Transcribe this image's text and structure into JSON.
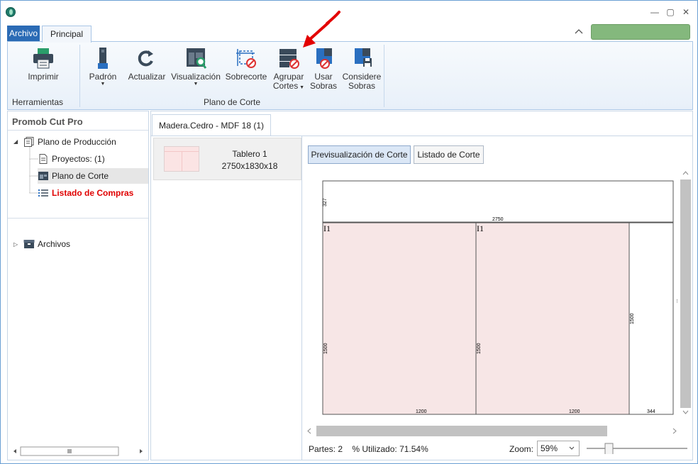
{
  "titlebar": {
    "minimize": "—",
    "maximize": "▢",
    "close": "✕"
  },
  "tabs": {
    "archivo": "Archivo",
    "principal": "Principal"
  },
  "ribbon": {
    "groups": {
      "herramientas": "Herramientas",
      "plano_de_corte": "Plano de Corte"
    },
    "buttons": {
      "imprimir": "Imprimir",
      "padron": "Padrón",
      "actualizar": "Actualizar",
      "visualizacion": "Visualización",
      "sobrecorte": "Sobrecorte",
      "agrupar_1": "Agrupar",
      "agrupar_2": "Cortes",
      "usar_1": "Usar",
      "usar_2": "Sobras",
      "considere_1": "Considere",
      "considere_2": "Sobras"
    }
  },
  "sidebar": {
    "title": "Promob Cut Pro",
    "items": [
      {
        "label": "Plano de Producción"
      },
      {
        "label": "Proyectos: (1)"
      },
      {
        "label": "Plano de Corte"
      },
      {
        "label": "Listado de Compras"
      },
      {
        "label": "Archivos"
      }
    ]
  },
  "document_tab": "Madera.Cedro - MDF 18 (1)",
  "board": {
    "name": "Tablero 1",
    "dims": "2750x1830x18"
  },
  "view_buttons": {
    "preview": "Previsualización de Corte",
    "list": "Listado de Corte"
  },
  "cutting_plan": {
    "top_strip_height": "327",
    "board_width": "2750",
    "piece_label": "I1",
    "piece_height": "1500",
    "piece_width": "1200",
    "remainder_height": "1500",
    "remainder_width": "344",
    "edge_marker": "..."
  },
  "status": {
    "parts": "Partes: 2",
    "utilized": "% Utilizado: 71.54%",
    "zoom_label": "Zoom:",
    "zoom_value": "59%"
  },
  "colors": {
    "accent": "#2b6bb5",
    "piece_fill": "#f7e6e6",
    "highlight_red": "#e00000",
    "status_green": "#84b87d"
  }
}
